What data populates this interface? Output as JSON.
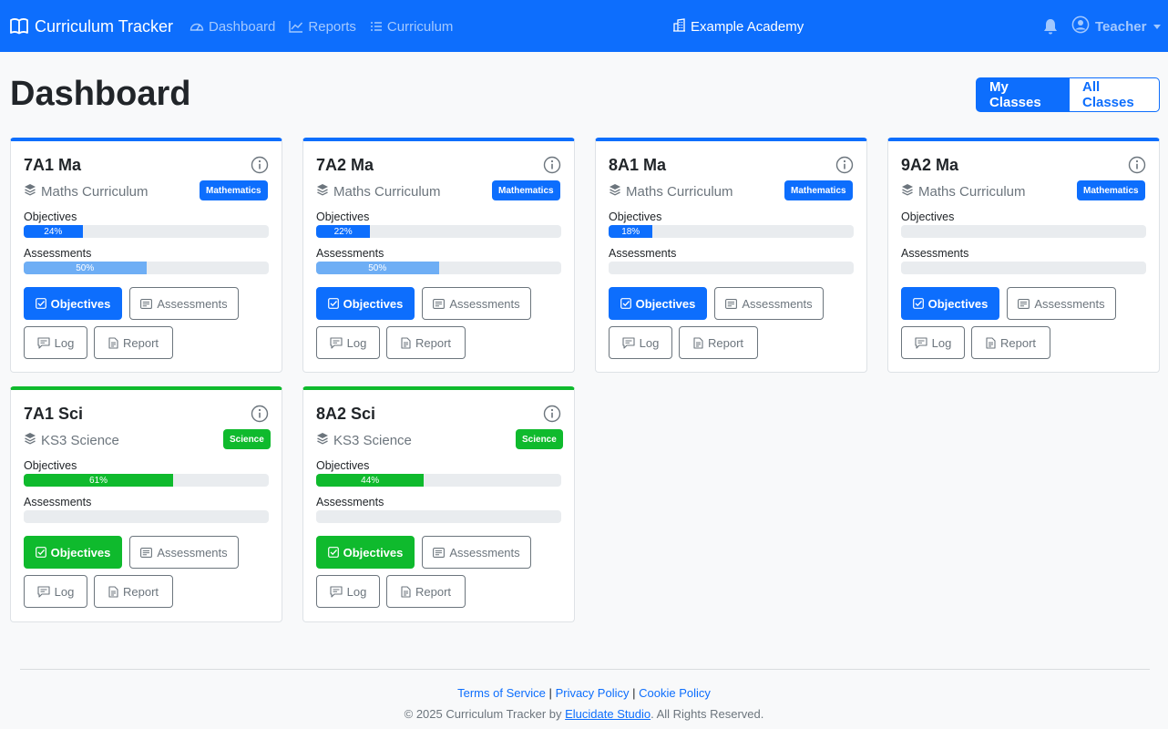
{
  "navbar": {
    "brand": "Curriculum Tracker",
    "links": [
      {
        "label": "Dashboard",
        "icon": "speedometer-icon"
      },
      {
        "label": "Reports",
        "icon": "graph-icon"
      },
      {
        "label": "Curriculum",
        "icon": "list-icon"
      }
    ],
    "school": "Example Academy",
    "user": "Teacher"
  },
  "header": {
    "title": "Dashboard",
    "toggle": {
      "active": "My Classes",
      "inactive": "All Classes"
    }
  },
  "buttons": {
    "objectives": "Objectives",
    "assessments": "Assessments",
    "log": "Log",
    "report": "Report"
  },
  "labels": {
    "objectives": "Objectives",
    "assessments": "Assessments"
  },
  "cards": [
    {
      "title": "7A1 Ma",
      "curriculum": "Maths Curriculum",
      "subject": "Mathematics",
      "objectives_pct": 24,
      "objectives_label": "24%",
      "assessments_pct": 50,
      "assessments_label": "50%"
    },
    {
      "title": "7A2 Ma",
      "curriculum": "Maths Curriculum",
      "subject": "Mathematics",
      "objectives_pct": 22,
      "objectives_label": "22%",
      "assessments_pct": 50,
      "assessments_label": "50%"
    },
    {
      "title": "8A1 Ma",
      "curriculum": "Maths Curriculum",
      "subject": "Mathematics",
      "objectives_pct": 18,
      "objectives_label": "18%",
      "assessments_pct": 0,
      "assessments_label": ""
    },
    {
      "title": "9A2 Ma",
      "curriculum": "Maths Curriculum",
      "subject": "Mathematics",
      "objectives_pct": 0,
      "objectives_label": "",
      "assessments_pct": 0,
      "assessments_label": ""
    },
    {
      "title": "7A1 Sci",
      "curriculum": "KS3 Science",
      "subject": "Science",
      "objectives_pct": 61,
      "objectives_label": "61%",
      "assessments_pct": 0,
      "assessments_label": ""
    },
    {
      "title": "8A2 Sci",
      "curriculum": "KS3 Science",
      "subject": "Science",
      "objectives_pct": 44,
      "objectives_label": "44%",
      "assessments_pct": 0,
      "assessments_label": ""
    }
  ],
  "colors": {
    "primary": "#0d6efd",
    "science": "#0fba2d",
    "assessment_fill": "#6eaef5"
  },
  "footer": {
    "terms": "Terms of Service",
    "privacy": "Privacy Policy",
    "cookie": "Cookie Policy",
    "separator": "|",
    "copyright_prefix": "© 2025 Curriculum Tracker by",
    "studio": "Elucidate Studio",
    "copyright_suffix": ". All Rights Reserved."
  }
}
